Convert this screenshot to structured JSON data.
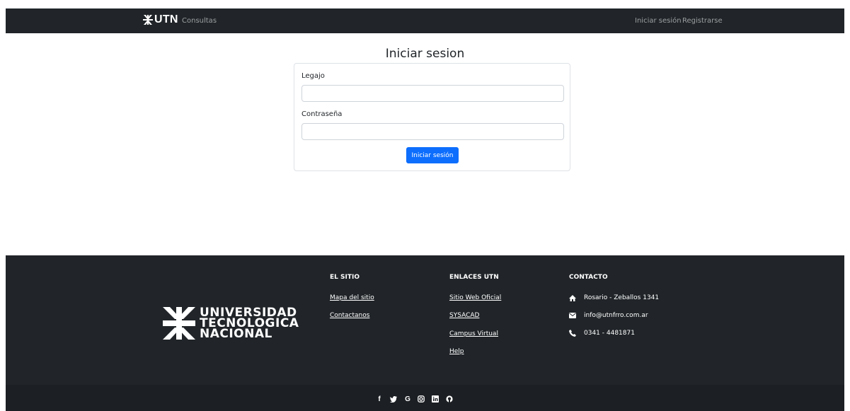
{
  "navbar": {
    "brand": "UTN",
    "brand_icon": "utn-logo-icon",
    "links": {
      "consultas": "Consultas",
      "login": "Iniciar sesión",
      "register": "Registrarse"
    }
  },
  "login": {
    "title": "Iniciar sesion",
    "legajo_label": "Legajo",
    "legajo_value": "",
    "password_label": "Contraseña",
    "password_value": "",
    "submit_label": "Iniciar sesión"
  },
  "footer": {
    "logo_lines": [
      "UNIVERSIDAD",
      "TECNOLOGICA",
      "NACIONAL"
    ],
    "el_sitio": {
      "title": "EL SITIO",
      "links": [
        "Mapa del sitio",
        "Contactanos"
      ]
    },
    "enlaces": {
      "title": "ENLACES UTN",
      "links": [
        "Sitio Web Oficial",
        "SYSACAD",
        "Campus Virtual",
        "Help"
      ]
    },
    "contacto": {
      "title": "CONTACTO",
      "items": [
        {
          "icon": "home-icon",
          "text": "Rosario - Zeballos 1341"
        },
        {
          "icon": "envelope-icon",
          "text": "info@utnfrro.com.ar"
        },
        {
          "icon": "phone-icon",
          "text": "0341 - 4481871"
        }
      ]
    },
    "social": [
      "facebook-icon",
      "twitter-icon",
      "google-icon",
      "instagram-icon",
      "linkedin-icon",
      "github-icon"
    ]
  },
  "colors": {
    "dark": "#212529",
    "primary": "#0d6efd",
    "border": "#dee2e6"
  }
}
